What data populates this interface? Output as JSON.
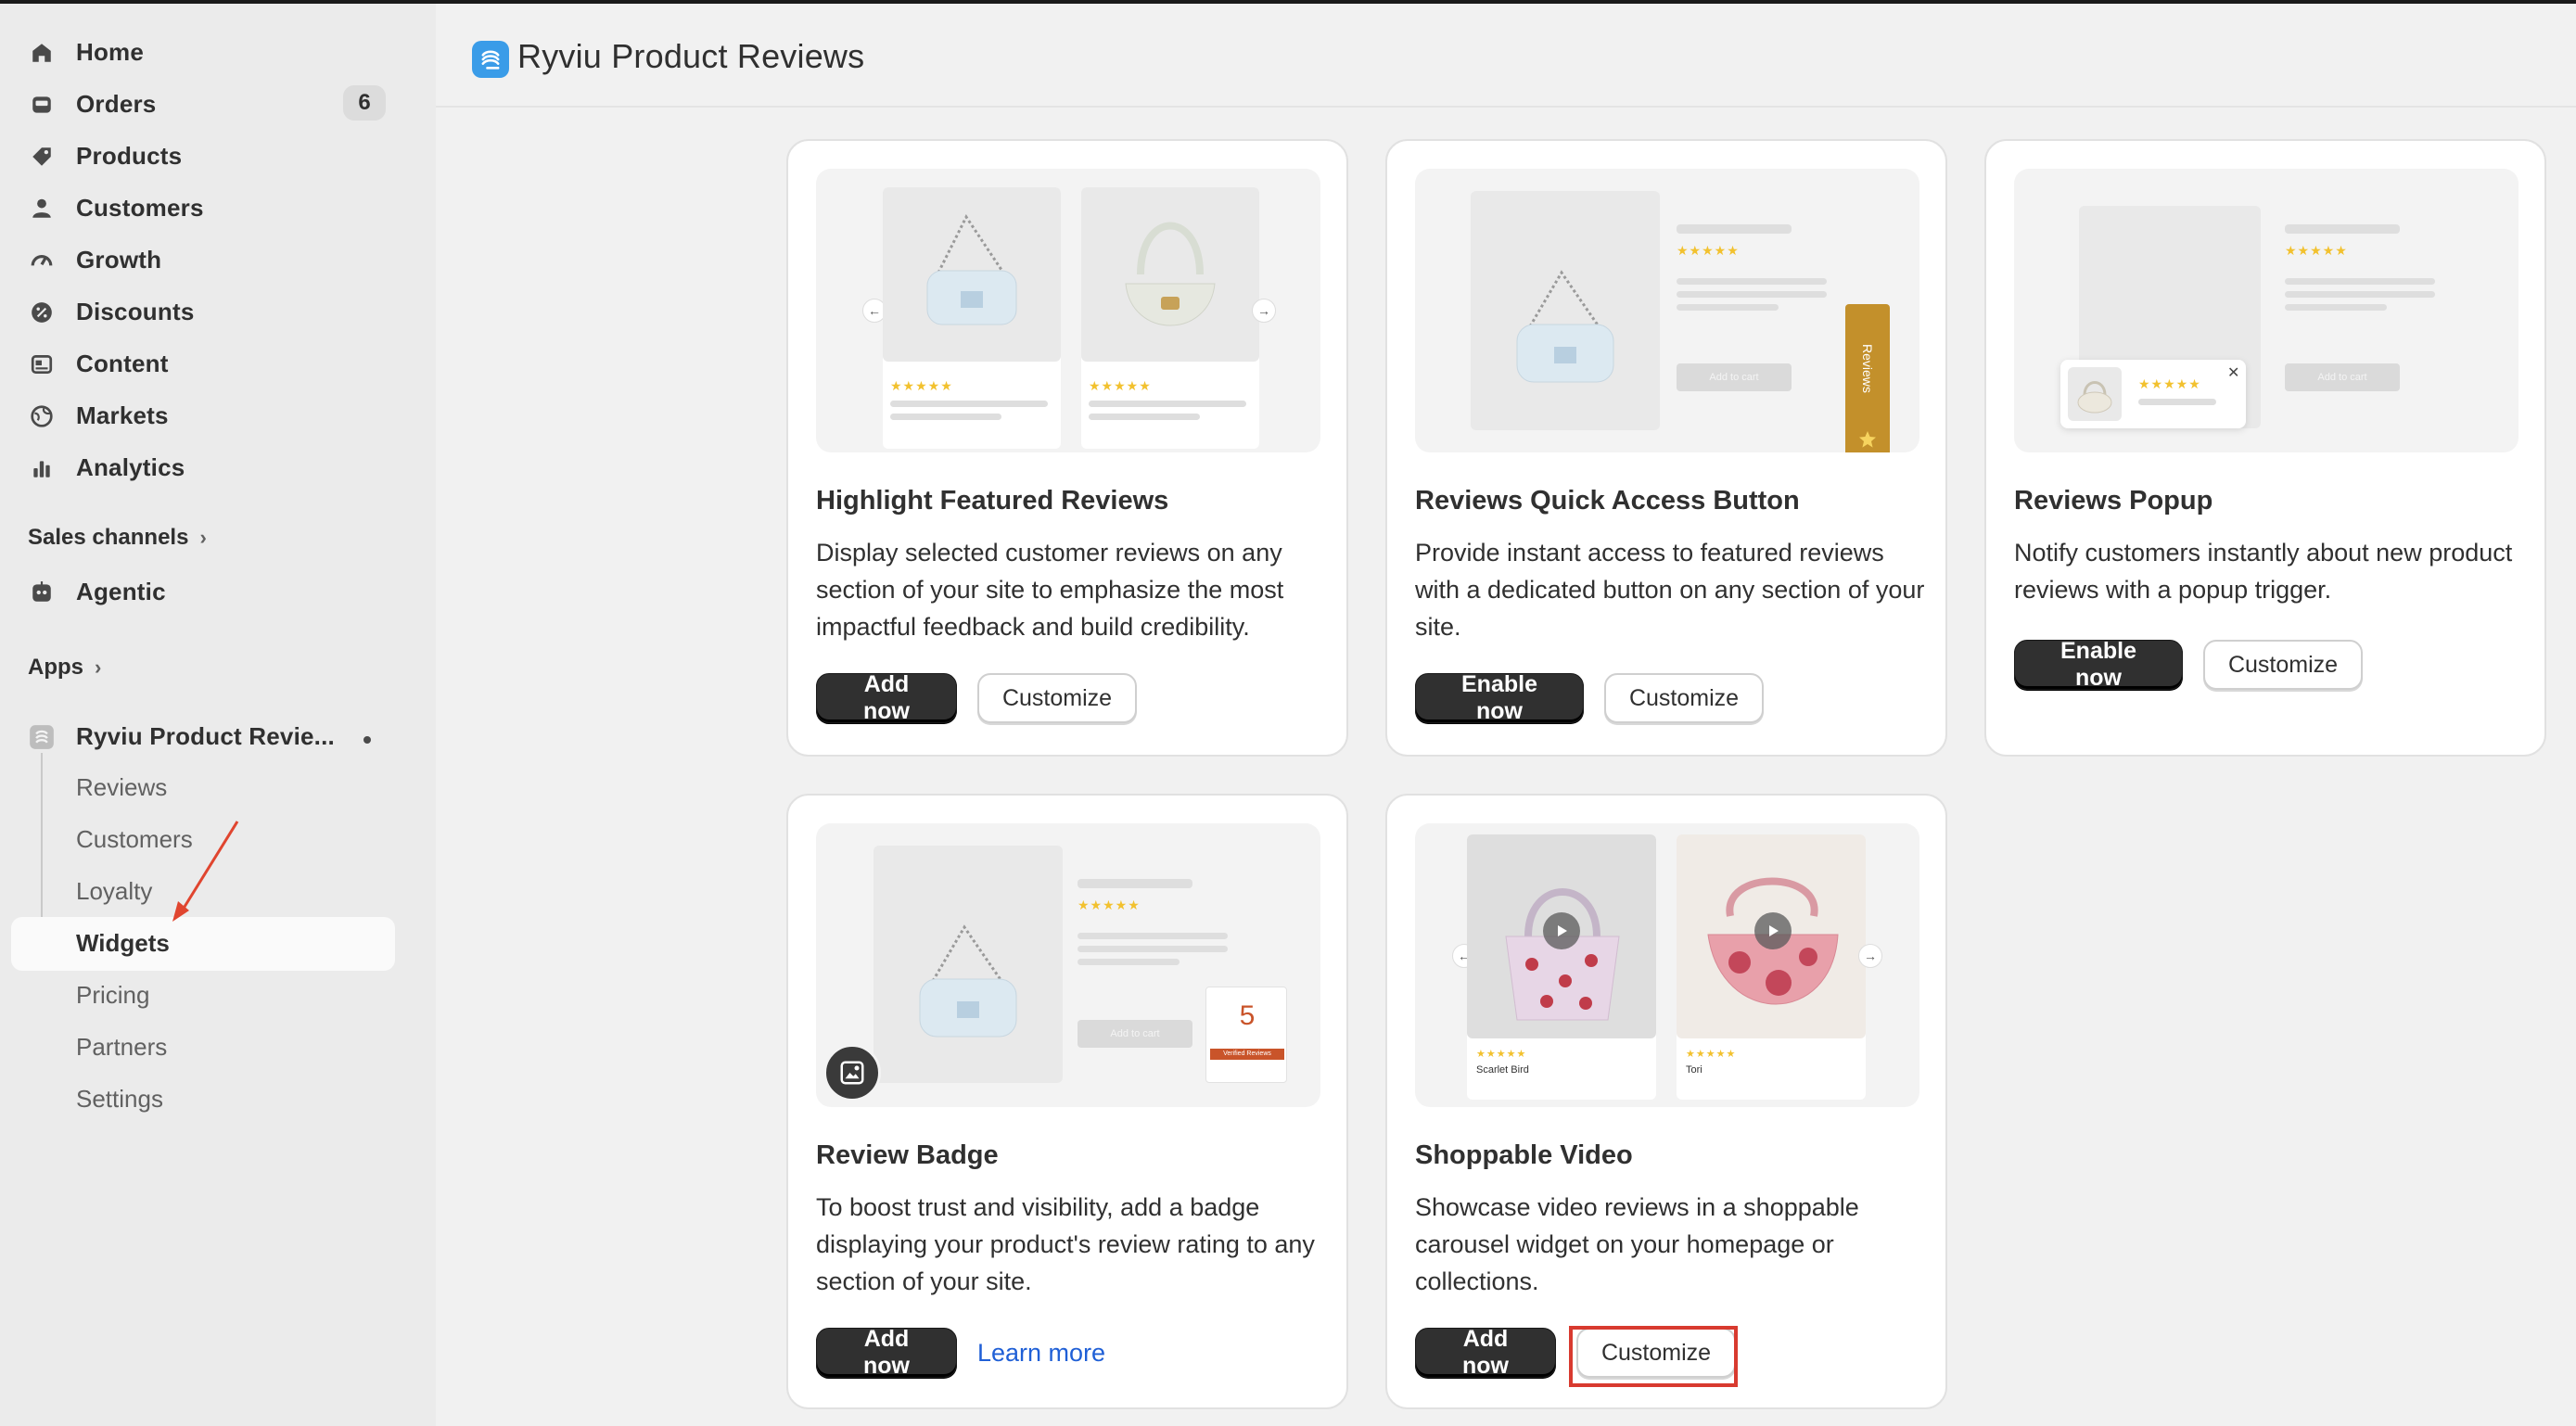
{
  "sidebar": {
    "nav": [
      {
        "label": "Home",
        "icon": "home-icon"
      },
      {
        "label": "Orders",
        "icon": "orders-icon",
        "count": "6"
      },
      {
        "label": "Products",
        "icon": "tag-icon"
      },
      {
        "label": "Customers",
        "icon": "person-icon"
      },
      {
        "label": "Growth",
        "icon": "gauge-icon"
      },
      {
        "label": "Discounts",
        "icon": "discount-icon"
      },
      {
        "label": "Content",
        "icon": "content-icon"
      },
      {
        "label": "Markets",
        "icon": "globe-icon"
      },
      {
        "label": "Analytics",
        "icon": "bar-chart-icon"
      }
    ],
    "sales_channels_label": "Sales channels",
    "agentic_label": "Agentic",
    "apps_label": "Apps",
    "app_name": "Ryviu Product Revie...",
    "app_subitems": [
      "Reviews",
      "Customers",
      "Loyalty",
      "Widgets",
      "Pricing",
      "Partners",
      "Settings"
    ],
    "active_subitem": "Widgets"
  },
  "header": {
    "title": "Ryviu Product Reviews"
  },
  "cards": [
    {
      "title": "Highlight Featured Reviews",
      "description": "Display selected customer reviews on any section of your site to emphasize the most impactful feedback and build credibility.",
      "primary": "Add now",
      "secondary": "Customize"
    },
    {
      "title": "Reviews Quick Access Button",
      "description": "Provide instant access to featured reviews with a dedicated button on any section of your site.",
      "primary": "Enable now",
      "secondary": "Customize",
      "preview_button": "Add to cart",
      "preview_tab": "Reviews"
    },
    {
      "title": "Reviews Popup",
      "description": "Notify customers instantly about new product reviews with a popup trigger.",
      "primary": "Enable now",
      "secondary": "Customize",
      "preview_button": "Add to cart"
    },
    {
      "title": "Review Badge",
      "description": "To boost trust and visibility, add a badge displaying your product's review rating to any section of your site.",
      "primary": "Add now",
      "link": "Learn more",
      "preview_button": "Add to cart",
      "badge_number": "5",
      "badge_strip": "Verified Reviews"
    },
    {
      "title": "Shoppable Video",
      "description": "Showcase video reviews in a shoppable carousel widget on your homepage or collections.",
      "primary": "Add now",
      "secondary": "Customize",
      "reviewer_1": "Scarlet Bird",
      "reviewer_2": "Tori"
    }
  ],
  "stars": "★★★★★",
  "colors": {
    "accent_dark": "#303030",
    "app_blue": "#3a9ce8",
    "highlight_red": "#d83a2f",
    "star_yellow": "#f2c12e",
    "link_blue": "#1f5fd6"
  }
}
